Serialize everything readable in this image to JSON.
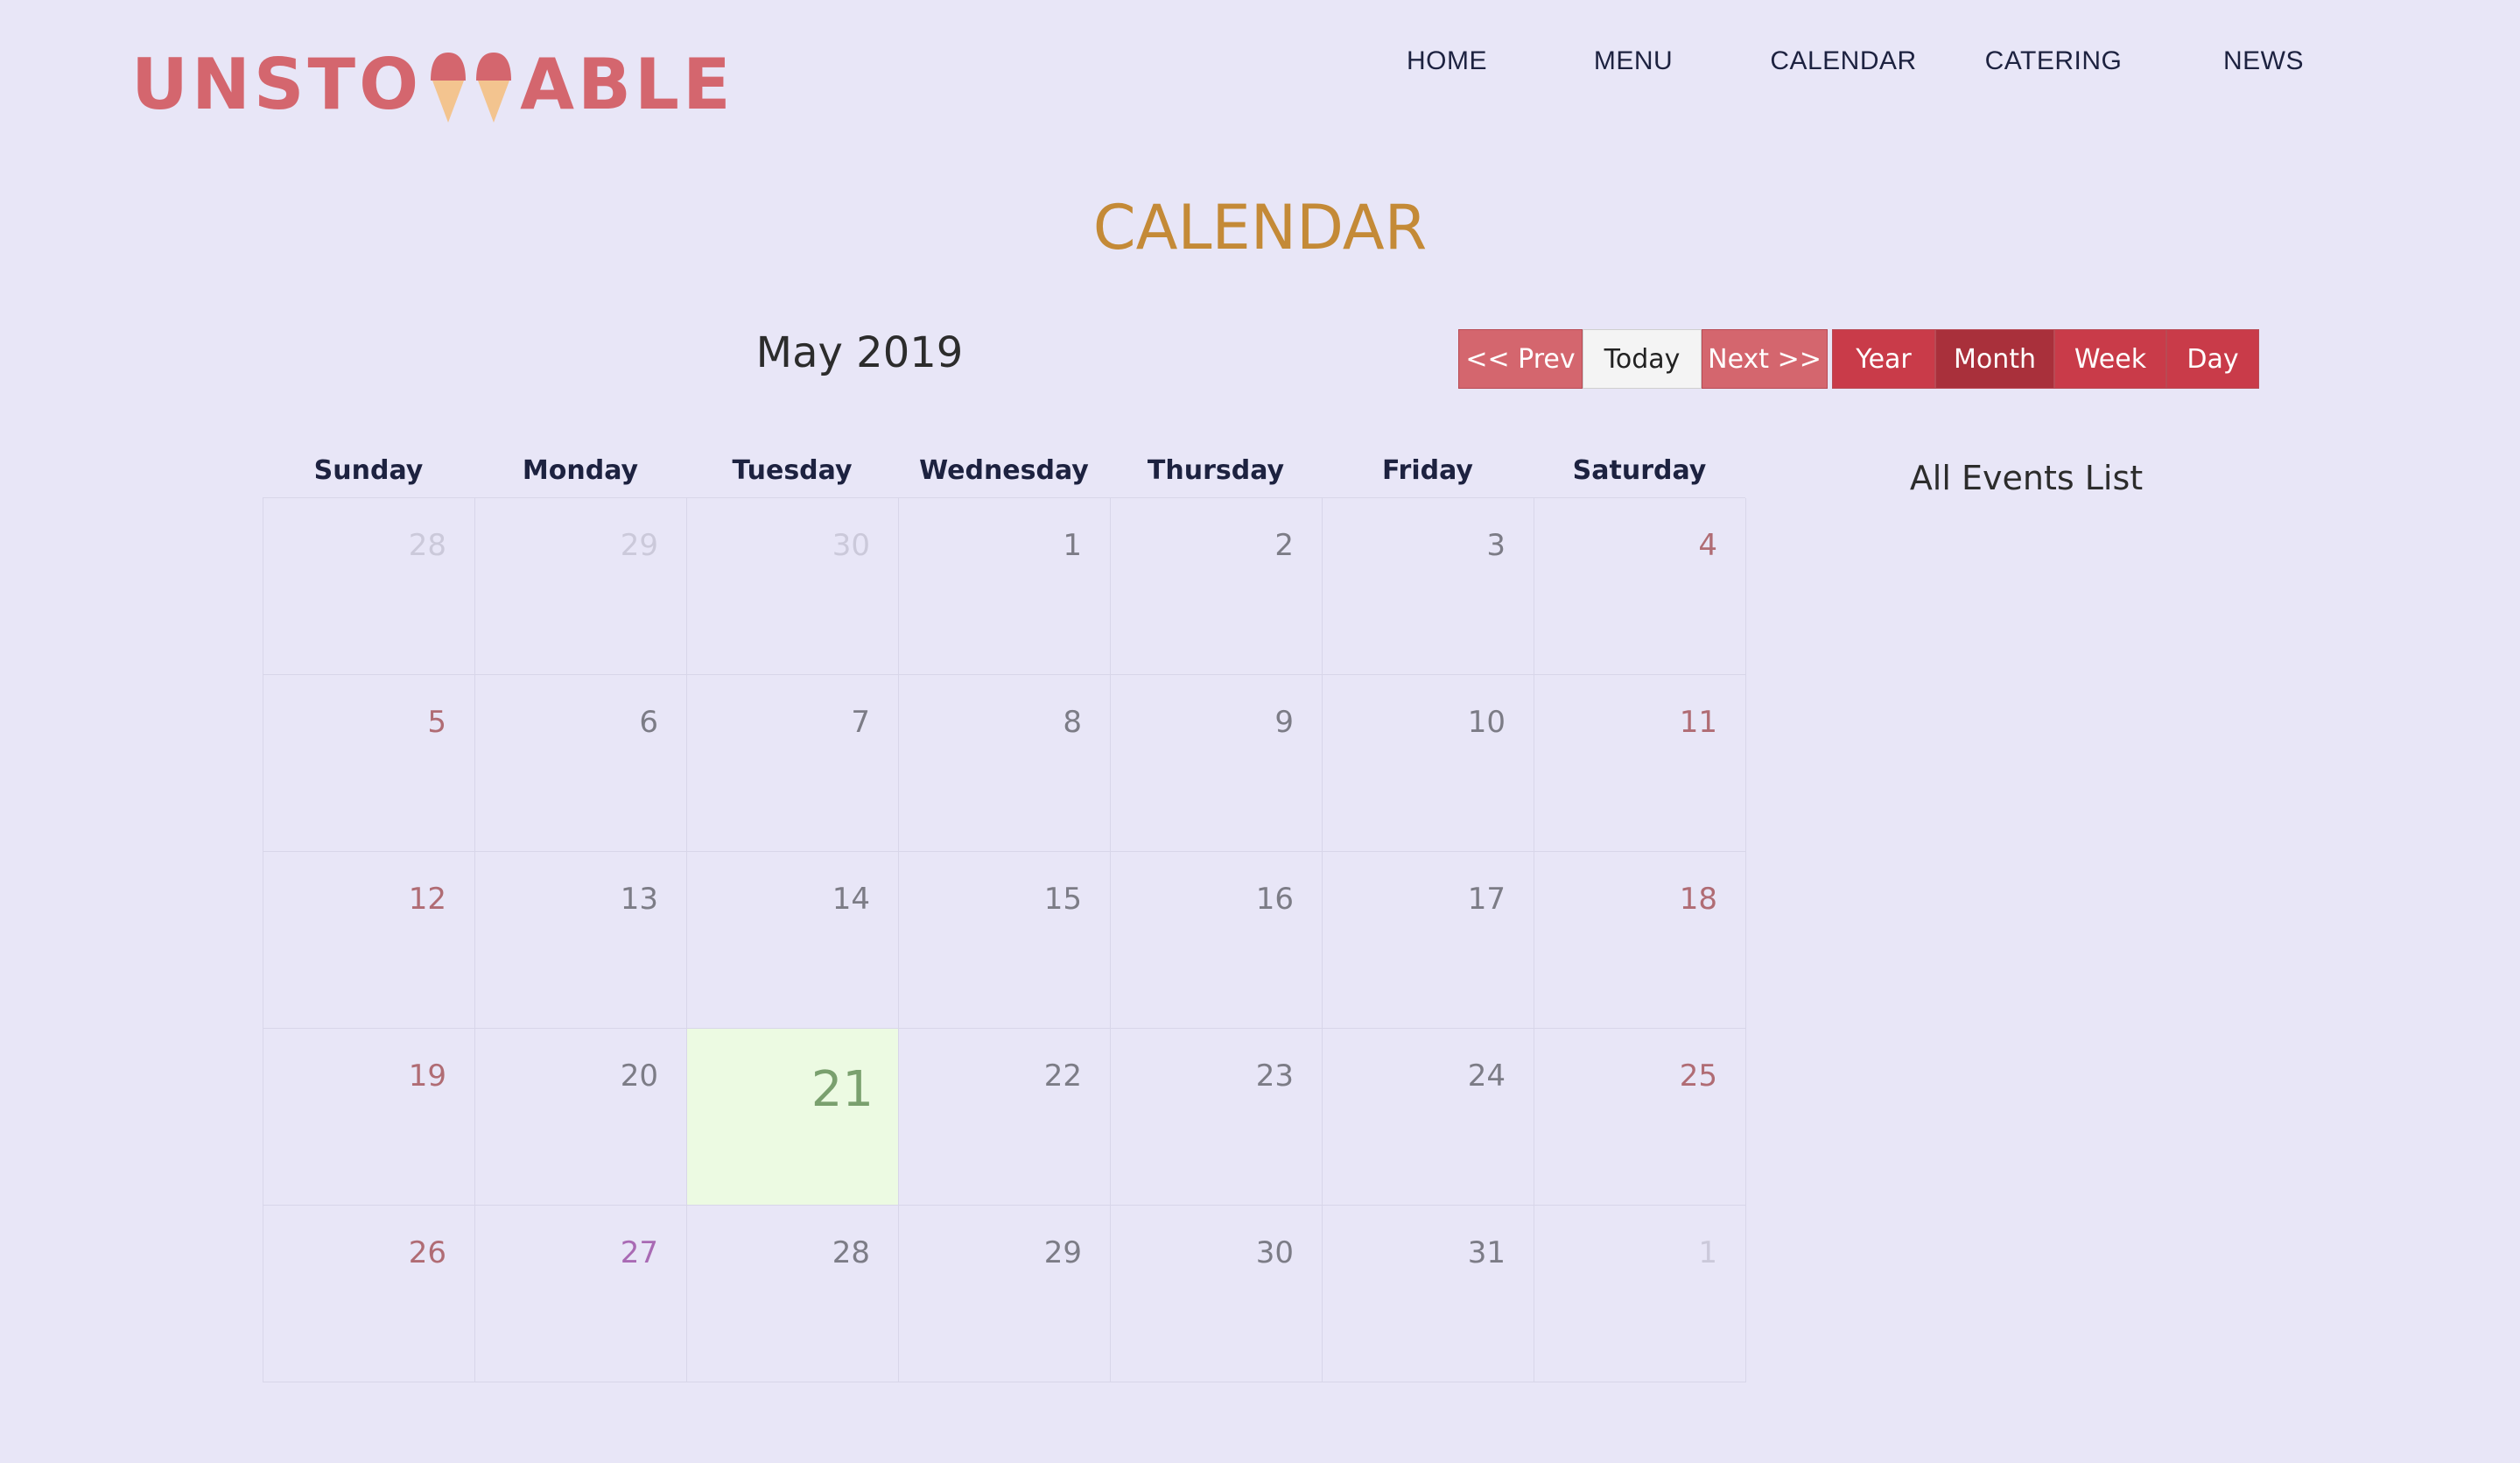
{
  "logo": {
    "text_left": "UNSTO",
    "text_right": "ABLE"
  },
  "nav": [
    "HOME",
    "MENU",
    "CALENDAR",
    "CATERING",
    "NEWS"
  ],
  "page_title": "CALENDAR",
  "calendar": {
    "month_title": "May 2019",
    "buttons": {
      "prev": "<< Prev",
      "today": "Today",
      "next": "Next >>",
      "year": "Year",
      "month": "Month",
      "week": "Week",
      "day": "Day"
    },
    "weekdays": [
      "Sunday",
      "Monday",
      "Tuesday",
      "Wednesday",
      "Thursday",
      "Friday",
      "Saturday"
    ],
    "weeks": [
      [
        "28",
        "29",
        "30",
        "1",
        "2",
        "3",
        "4"
      ],
      [
        "5",
        "6",
        "7",
        "8",
        "9",
        "10",
        "11"
      ],
      [
        "12",
        "13",
        "14",
        "15",
        "16",
        "17",
        "18"
      ],
      [
        "19",
        "20",
        "21",
        "22",
        "23",
        "24",
        "25"
      ],
      [
        "26",
        "27",
        "28",
        "29",
        "30",
        "31",
        "1"
      ]
    ],
    "today": "21"
  },
  "events": {
    "title": "All Events List"
  },
  "colors": {
    "accent_pink": "#d4666e",
    "accent_red": "#c93b49",
    "active_red": "#a9303b",
    "title_gold": "#c48a37",
    "today_bg": "#ecfae2"
  }
}
